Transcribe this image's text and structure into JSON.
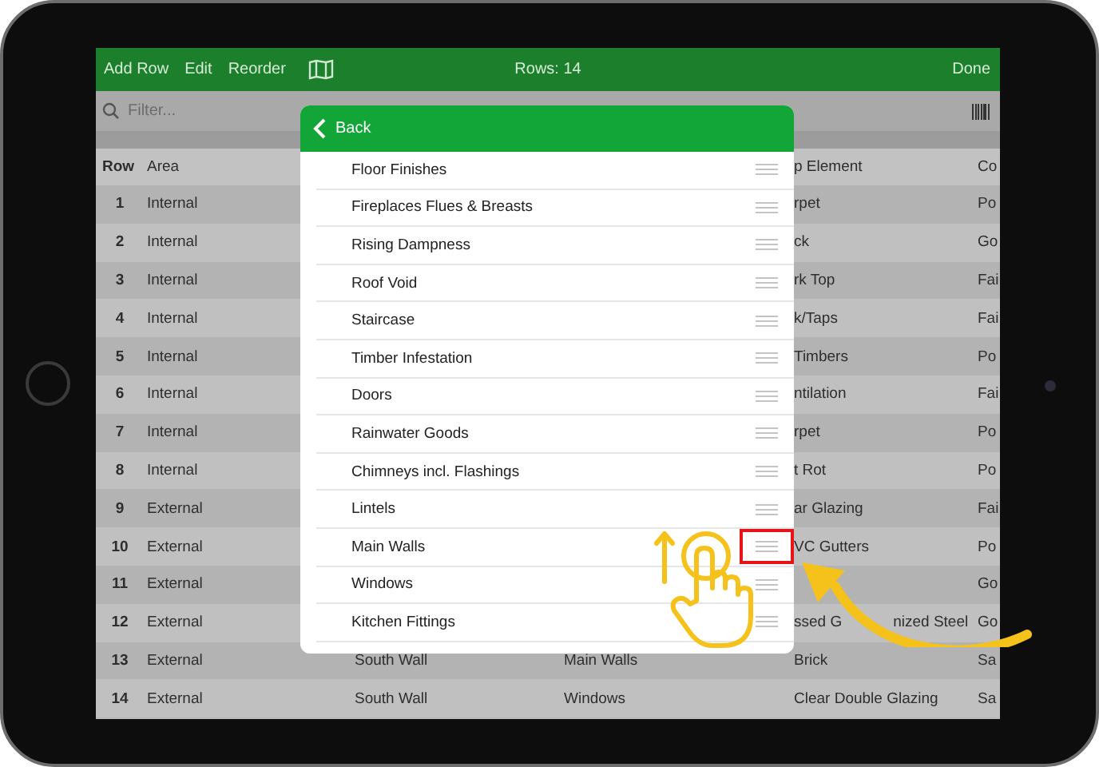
{
  "toolbar": {
    "buttons": [
      "Add Row",
      "Edit",
      "Reorder"
    ],
    "title": "Rows: 14",
    "done": "Done"
  },
  "filter": {
    "placeholder": "Filter..."
  },
  "table": {
    "columns": [
      "Row",
      "Area",
      "",
      "",
      "p Element",
      "Co"
    ],
    "rows": [
      {
        "cells": [
          "1",
          "Internal",
          "",
          "",
          "rpet",
          "Po"
        ]
      },
      {
        "cells": [
          "2",
          "Internal",
          "",
          "",
          "ck",
          "Go"
        ]
      },
      {
        "cells": [
          "3",
          "Internal",
          "",
          "",
          "rk Top",
          "Fai"
        ]
      },
      {
        "cells": [
          "4",
          "Internal",
          "",
          "",
          "k/Taps",
          "Fai"
        ]
      },
      {
        "cells": [
          "5",
          "Internal",
          "",
          "",
          "Timbers",
          "Po"
        ]
      },
      {
        "cells": [
          "6",
          "Internal",
          "",
          "",
          "ntilation",
          "Fai"
        ]
      },
      {
        "cells": [
          "7",
          "Internal",
          "",
          "",
          "rpet",
          "Po"
        ]
      },
      {
        "cells": [
          "8",
          "Internal",
          "",
          "",
          "t Rot",
          "Po"
        ]
      },
      {
        "cells": [
          "9",
          "External",
          "",
          "",
          "ar Glazing",
          "Fai"
        ]
      },
      {
        "cells": [
          "10",
          "External",
          "",
          "",
          "VC Gutters",
          "Po"
        ]
      },
      {
        "cells": [
          "11",
          "External",
          "",
          "",
          "",
          "Go"
        ]
      },
      {
        "cells": [
          "12",
          "External",
          "",
          "",
          "ssed G",
          "Go"
        ],
        "cell_4_after_arrow": "nized Steel"
      },
      {
        "cells": [
          "13",
          "External",
          "South Wall",
          "Main Walls",
          "Brick",
          "Sa"
        ]
      },
      {
        "cells": [
          "14",
          "External",
          "South Wall",
          "Windows",
          "Clear Double Glazing",
          "Sa"
        ]
      }
    ]
  },
  "popup": {
    "back": "Back",
    "items": [
      {
        "label": "Floor Finishes",
        "marked": false
      },
      {
        "label": "Fireplaces Flues & Breasts",
        "marked": false
      },
      {
        "label": "Rising Dampness",
        "marked": false
      },
      {
        "label": "Roof Void",
        "marked": false
      },
      {
        "label": "Staircase",
        "marked": false
      },
      {
        "label": "Timber Infestation",
        "marked": false
      },
      {
        "label": "Doors",
        "marked": false
      },
      {
        "label": "Rainwater Goods",
        "marked": false
      },
      {
        "label": "Chimneys incl. Flashings",
        "marked": false
      },
      {
        "label": "Lintels",
        "marked": false
      },
      {
        "label": "Main Walls",
        "marked": true
      },
      {
        "label": "Windows",
        "marked": false
      },
      {
        "label": "Kitchen Fittings",
        "marked": false
      }
    ]
  }
}
